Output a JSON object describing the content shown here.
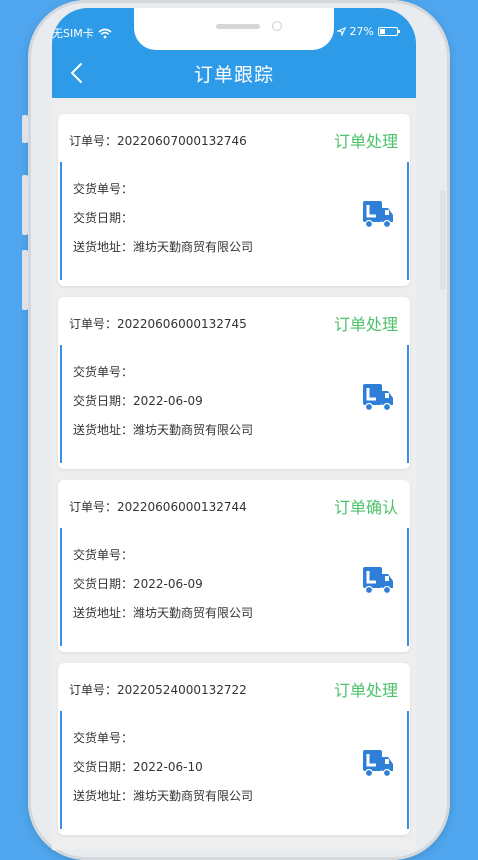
{
  "status_bar": {
    "carrier": "无SIM卡",
    "battery": "27%",
    "icons": [
      "wifi-icon",
      "location-arrow-icon",
      "battery-icon"
    ]
  },
  "header": {
    "title": "订单跟踪",
    "back_icon": "chevron-left-icon"
  },
  "colors": {
    "header_bg": "#2d9be8",
    "status_green": "#4cc26b",
    "accent_blue": "#3b8ee6",
    "page_bg": "#4fa6ee"
  },
  "orders": [
    {
      "order_label": "订单号：20220607000132746",
      "status": "订单处理",
      "delivery_no_label": "交货单号：",
      "delivery_date_label": "交货日期：",
      "address_label": "送货地址：潍坊天勤商贸有限公司",
      "icon": "delivery-truck-icon"
    },
    {
      "order_label": "订单号：20220606000132745",
      "status": "订单处理",
      "delivery_no_label": "交货单号：",
      "delivery_date_label": "交货日期：2022-06-09",
      "address_label": "送货地址：潍坊天勤商贸有限公司",
      "icon": "delivery-truck-icon"
    },
    {
      "order_label": "订单号：20220606000132744",
      "status": "订单确认",
      "delivery_no_label": "交货单号：",
      "delivery_date_label": "交货日期：2022-06-09",
      "address_label": "送货地址：潍坊天勤商贸有限公司",
      "icon": "delivery-truck-icon"
    },
    {
      "order_label": "订单号：20220524000132722",
      "status": "订单处理",
      "delivery_no_label": "交货单号：",
      "delivery_date_label": "交货日期：2022-06-10",
      "address_label": "送货地址：潍坊天勤商贸有限公司",
      "icon": "delivery-truck-icon"
    }
  ]
}
